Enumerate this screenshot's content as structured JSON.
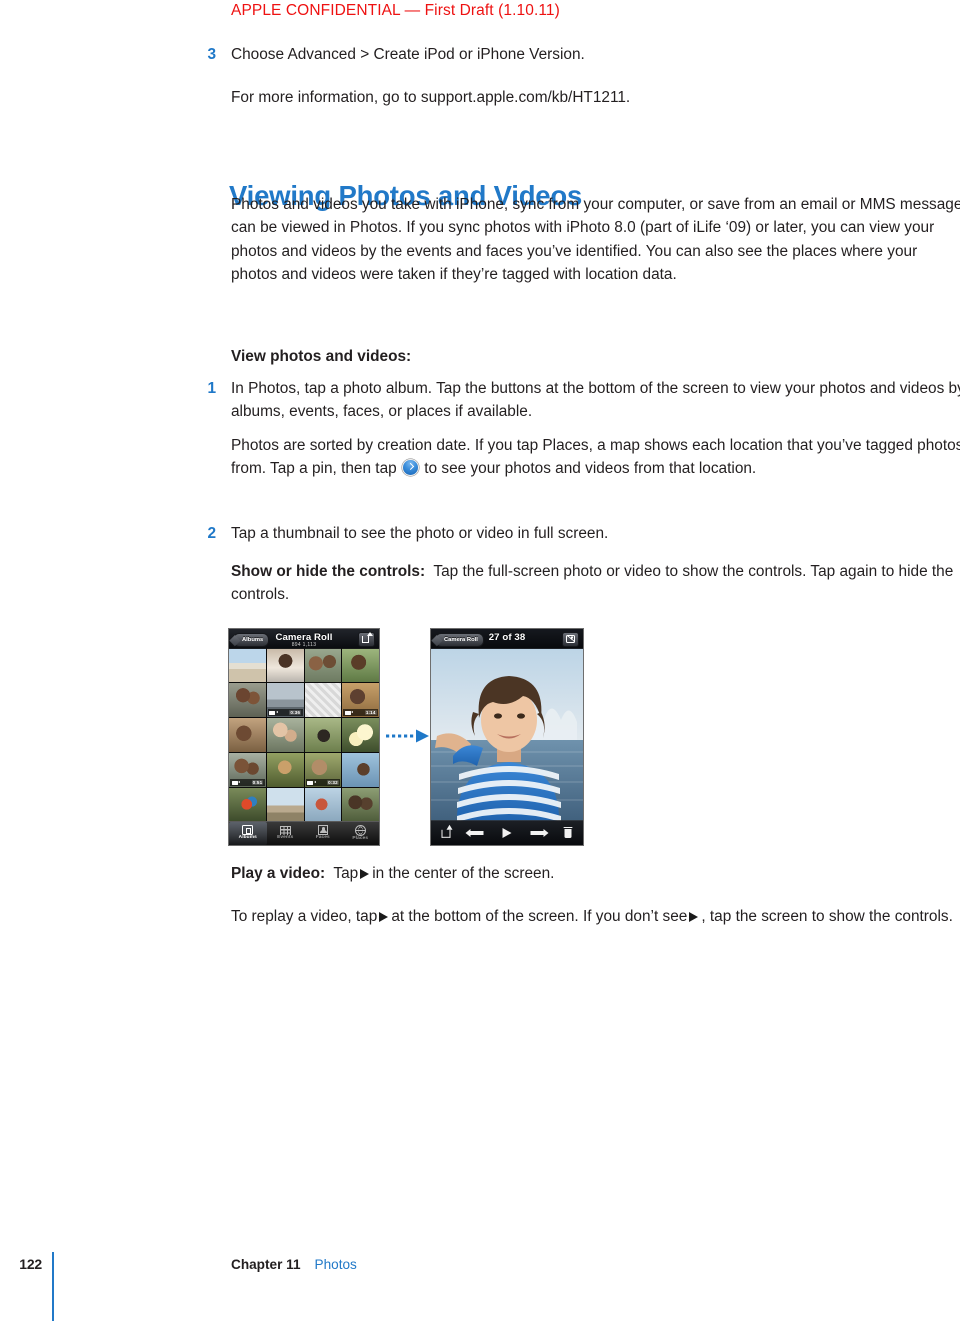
{
  "document": {
    "confidential_banner": "APPLE CONFIDENTIAL  —  First Draft (1.10.11)",
    "page_number": "122",
    "footer_chapter": "Chapter 11",
    "footer_chapter_title": "Photos",
    "accent_blue": "#2179c8",
    "confidential_red": "#ee1111",
    "body_color": "#231f20"
  },
  "content": {
    "step3_num": "3",
    "step3_text": "Choose Advanced > Create iPod or iPhone Version.",
    "step3_followup": "For more information, go to support.apple.com/kb/HT1211.",
    "section_heading": "Viewing Photos and Videos",
    "intro_paragraph": "Photos and videos you take with iPhone, sync from your computer, or save from an email or MMS message can be viewed in Photos. If you sync photos with iPhoto 8.0 (part of iLife ‘09) or later, you can view your photos and videos by the events and faces you’ve identified. You can also see the places where your photos and videos were taken if they’re tagged with location data.",
    "task_heading": "View photos and videos:",
    "step1_num": "1",
    "step1_text": "In Photos, tap a photo album. Tap the buttons at the bottom of the screen to view your photos and videos by albums, events, faces, or places if available.",
    "step1_followup_a": "Photos are sorted by creation date. If you tap Places, a map shows each location that you’ve tagged photos from. Tap a pin, then tap ",
    "step1_followup_b": " to see your photos and videos from that location.",
    "step2_num": "2",
    "step2_text": "Tap a thumbnail to see the photo or video in full screen.",
    "show_hide_runin": "Show or hide the controls:",
    "show_hide_text": "Tap the full-screen photo or video to show the controls. Tap again to hide the controls.",
    "play_video_runin": "Play a video:",
    "play_video_a": "Tap",
    "play_video_b": "in the center of the screen.",
    "replay_a": "To replay a video, tap",
    "replay_b": "at the bottom of the screen. If you don’t see",
    "replay_c": ", tap the screen to show the controls."
  },
  "figure": {
    "grid_phone": {
      "nav_back_label": "Albums",
      "nav_title": "Camera Roll",
      "nav_subtitle": "894      1,113",
      "share_button": "share-button",
      "video_badges": [
        {
          "cell": 6,
          "duration": "0:36"
        },
        {
          "cell": 8,
          "duration": "1:14"
        },
        {
          "cell": 13,
          "duration": "0:51"
        },
        {
          "cell": 15,
          "duration": "0:32"
        }
      ],
      "tabs": [
        {
          "label": "Albums",
          "icon": "albums-icon",
          "selected": true
        },
        {
          "label": "Events",
          "icon": "events-icon",
          "selected": false
        },
        {
          "label": "Faces",
          "icon": "faces-icon",
          "selected": false
        },
        {
          "label": "Places",
          "icon": "places-icon",
          "selected": false
        }
      ]
    },
    "photo_phone": {
      "nav_back_label": "Camera Roll",
      "nav_title": "27 of 38",
      "slideshow_button": "slideshow-button",
      "toolbar": [
        {
          "name": "share-button",
          "icon": "share-icon"
        },
        {
          "name": "previous-button",
          "icon": "arrow-left-icon"
        },
        {
          "name": "play-button",
          "icon": "play-icon"
        },
        {
          "name": "next-button",
          "icon": "arrow-right-icon"
        },
        {
          "name": "delete-button",
          "icon": "trash-icon"
        }
      ]
    }
  }
}
